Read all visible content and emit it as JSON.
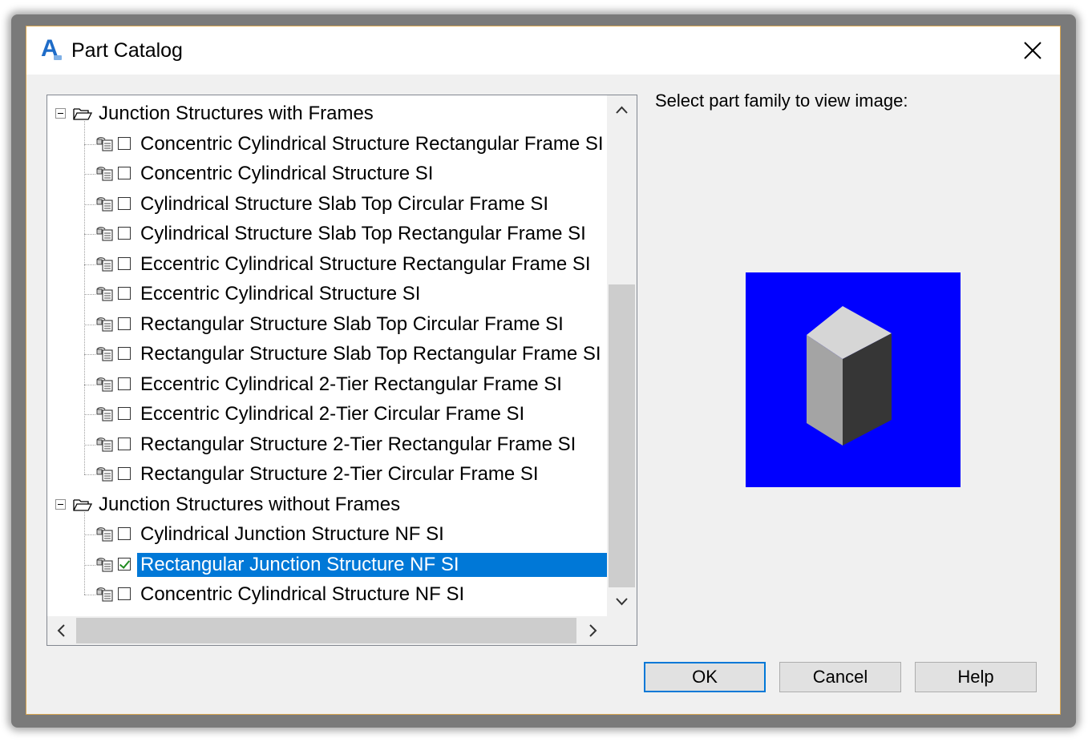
{
  "window": {
    "title": "Part Catalog",
    "close_icon": "close-icon",
    "app_icon": "autocad-icon",
    "app_icon_letter": "A"
  },
  "tree": {
    "groups": [
      {
        "label": "Junction Structures with Frames",
        "expanded": true,
        "items": [
          {
            "label": "Concentric Cylindrical Structure Rectangular Frame SI",
            "checked": false
          },
          {
            "label": "Concentric Cylindrical Structure SI",
            "checked": false
          },
          {
            "label": "Cylindrical Structure Slab Top Circular Frame SI",
            "checked": false
          },
          {
            "label": "Cylindrical Structure Slab Top Rectangular Frame SI",
            "checked": false
          },
          {
            "label": "Eccentric Cylindrical Structure Rectangular Frame SI",
            "checked": false
          },
          {
            "label": "Eccentric Cylindrical Structure SI",
            "checked": false
          },
          {
            "label": "Rectangular Structure Slab Top Circular Frame SI",
            "checked": false
          },
          {
            "label": "Rectangular Structure Slab Top Rectangular Frame SI",
            "checked": false
          },
          {
            "label": "Eccentric Cylindrical 2-Tier Rectangular Frame SI",
            "checked": false
          },
          {
            "label": "Eccentric Cylindrical 2-Tier Circular Frame SI",
            "checked": false
          },
          {
            "label": "Rectangular Structure 2-Tier Rectangular Frame SI",
            "checked": false
          },
          {
            "label": "Rectangular Structure 2-Tier Circular Frame SI",
            "checked": false
          }
        ]
      },
      {
        "label": "Junction Structures without Frames",
        "expanded": true,
        "items": [
          {
            "label": "Cylindrical Junction Structure NF SI",
            "checked": false
          },
          {
            "label": "Rectangular Junction Structure NF SI",
            "checked": true,
            "selected": true
          },
          {
            "label": "Concentric Cylindrical Structure NF SI",
            "checked": false
          }
        ]
      }
    ]
  },
  "preview": {
    "prompt": "Select part family to view image:",
    "background_color": "#0000ff",
    "image": "rectangular-structure-box-image"
  },
  "buttons": {
    "ok": "OK",
    "cancel": "Cancel",
    "help": "Help"
  },
  "colors": {
    "selection": "#0078d7",
    "default_button_border": "#0078d7"
  }
}
